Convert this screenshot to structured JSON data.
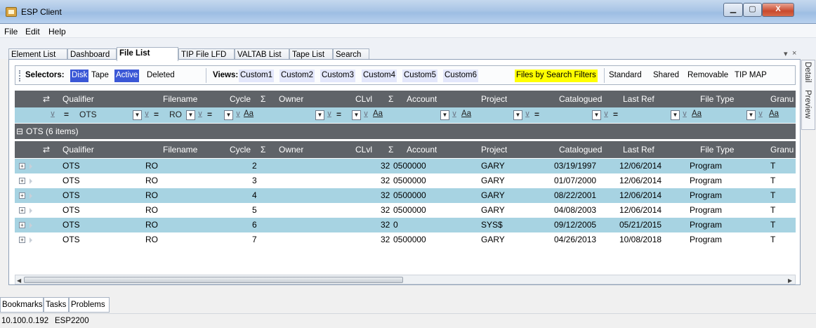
{
  "window": {
    "title": "ESP Client",
    "min_glyph": "▁",
    "max_glyph": "▢",
    "close_glyph": "X"
  },
  "menu": [
    "File",
    "Edit",
    "Help"
  ],
  "doc_tabs": [
    "Element List",
    "Dashboard",
    "File List",
    "TIP File LFD",
    "VALTAB List",
    "Tape List",
    "Search"
  ],
  "active_tab": "File List",
  "tab_controls": {
    "dropdown": "▾",
    "close": "×"
  },
  "side_tabs": [
    "Detail",
    "Preview"
  ],
  "toolbar": {
    "selectors_label": "Selectors:",
    "disk": "Disk",
    "tape": "Tape",
    "active": "Active",
    "deleted": "Deleted",
    "views_label": "Views:",
    "views": [
      "Custom1",
      "Custom2",
      "Custom3",
      "Custom4",
      "Custom5",
      "Custom6"
    ],
    "search_filters": "Files by Search Filters",
    "extra": [
      "Standard",
      "Shared",
      "Removable",
      "TIP MAP"
    ],
    "colors": {
      "selected": "#3a57d6",
      "highlight": "#ffff00"
    }
  },
  "columns": [
    "Qualifier",
    "Filename",
    "Cycle",
    "Owner",
    "CLvl",
    "Account",
    "Project",
    "Catalogued",
    "Last Ref",
    "File Type",
    "Granu"
  ],
  "sigma": "Σ",
  "filter": {
    "eq": "=",
    "qualifier_value": "OTS",
    "filename_value": "RO",
    "aa": "Aa",
    "clear_icon": "⊻"
  },
  "group": {
    "label": "OTS (6 items)",
    "toggle": "⊟"
  },
  "rows": [
    {
      "qualifier": "OTS",
      "filename": "RO",
      "cycle": "2",
      "owner": "",
      "clvl": "32",
      "account": "0500000",
      "project": "GARY",
      "catalogued": "03/19/1997",
      "last_ref": "12/06/2014",
      "file_type": "Program",
      "granu": "T"
    },
    {
      "qualifier": "OTS",
      "filename": "RO",
      "cycle": "3",
      "owner": "",
      "clvl": "32",
      "account": "0500000",
      "project": "GARY",
      "catalogued": "01/07/2000",
      "last_ref": "12/06/2014",
      "file_type": "Program",
      "granu": "T"
    },
    {
      "qualifier": "OTS",
      "filename": "RO",
      "cycle": "4",
      "owner": "",
      "clvl": "32",
      "account": "0500000",
      "project": "GARY",
      "catalogued": "08/22/2001",
      "last_ref": "12/06/2014",
      "file_type": "Program",
      "granu": "T"
    },
    {
      "qualifier": "OTS",
      "filename": "RO",
      "cycle": "5",
      "owner": "",
      "clvl": "32",
      "account": "0500000",
      "project": "GARY",
      "catalogued": "04/08/2003",
      "last_ref": "12/06/2014",
      "file_type": "Program",
      "granu": "T"
    },
    {
      "qualifier": "OTS",
      "filename": "RO",
      "cycle": "6",
      "owner": "",
      "clvl": "32",
      "account": "0",
      "project": "SYS$",
      "catalogued": "09/12/2005",
      "last_ref": "05/21/2015",
      "file_type": "Program",
      "granu": "T"
    },
    {
      "qualifier": "OTS",
      "filename": "RO",
      "cycle": "7",
      "owner": "",
      "clvl": "32",
      "account": "0500000",
      "project": "GARY",
      "catalogued": "04/26/2013",
      "last_ref": "10/08/2018",
      "file_type": "Program",
      "granu": "T"
    }
  ],
  "bottom_tabs": [
    "Bookmarks",
    "Tasks",
    "Problems"
  ],
  "status": {
    "ip": "10.100.0.192",
    "host": "ESP2200"
  }
}
